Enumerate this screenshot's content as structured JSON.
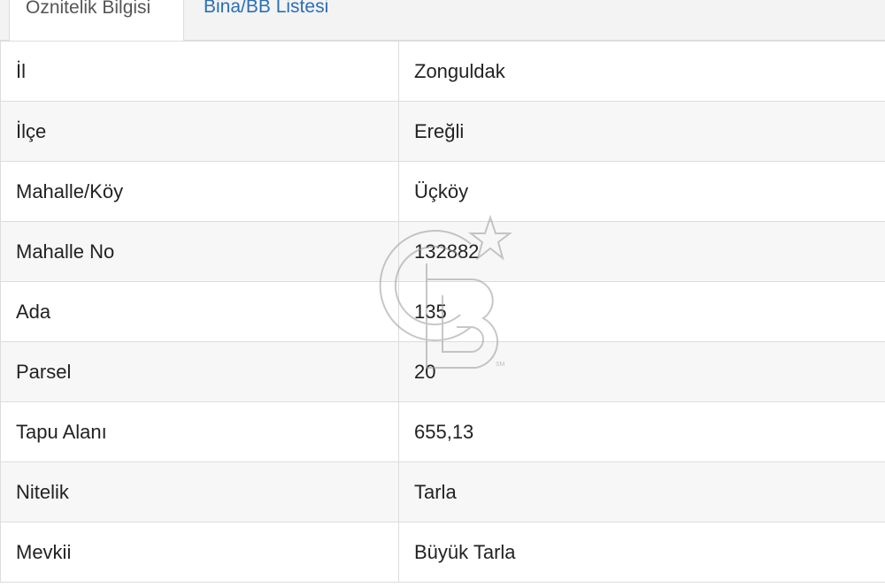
{
  "tabs": [
    {
      "label": "Öznitelik Bilgisi",
      "active": true
    },
    {
      "label": "Bina/BB Listesi",
      "active": false
    }
  ],
  "rows": [
    {
      "key": "İl",
      "value": "Zonguldak"
    },
    {
      "key": "İlçe",
      "value": "Ereğli"
    },
    {
      "key": "Mahalle/Köy",
      "value": "Üçköy"
    },
    {
      "key": "Mahalle No",
      "value": "132882"
    },
    {
      "key": "Ada",
      "value": "135"
    },
    {
      "key": "Parsel",
      "value": "20"
    },
    {
      "key": "Tapu Alanı",
      "value": "655,13"
    },
    {
      "key": "Nitelik",
      "value": "Tarla"
    },
    {
      "key": "Mevkii",
      "value": "Büyük Tarla"
    }
  ],
  "watermark": {
    "icon": "cb-logo-watermark",
    "mark_text": "SM"
  },
  "colors": {
    "tab_link": "#2a6fb5",
    "border": "#dddddd",
    "stripe": "#f7f7f7"
  }
}
